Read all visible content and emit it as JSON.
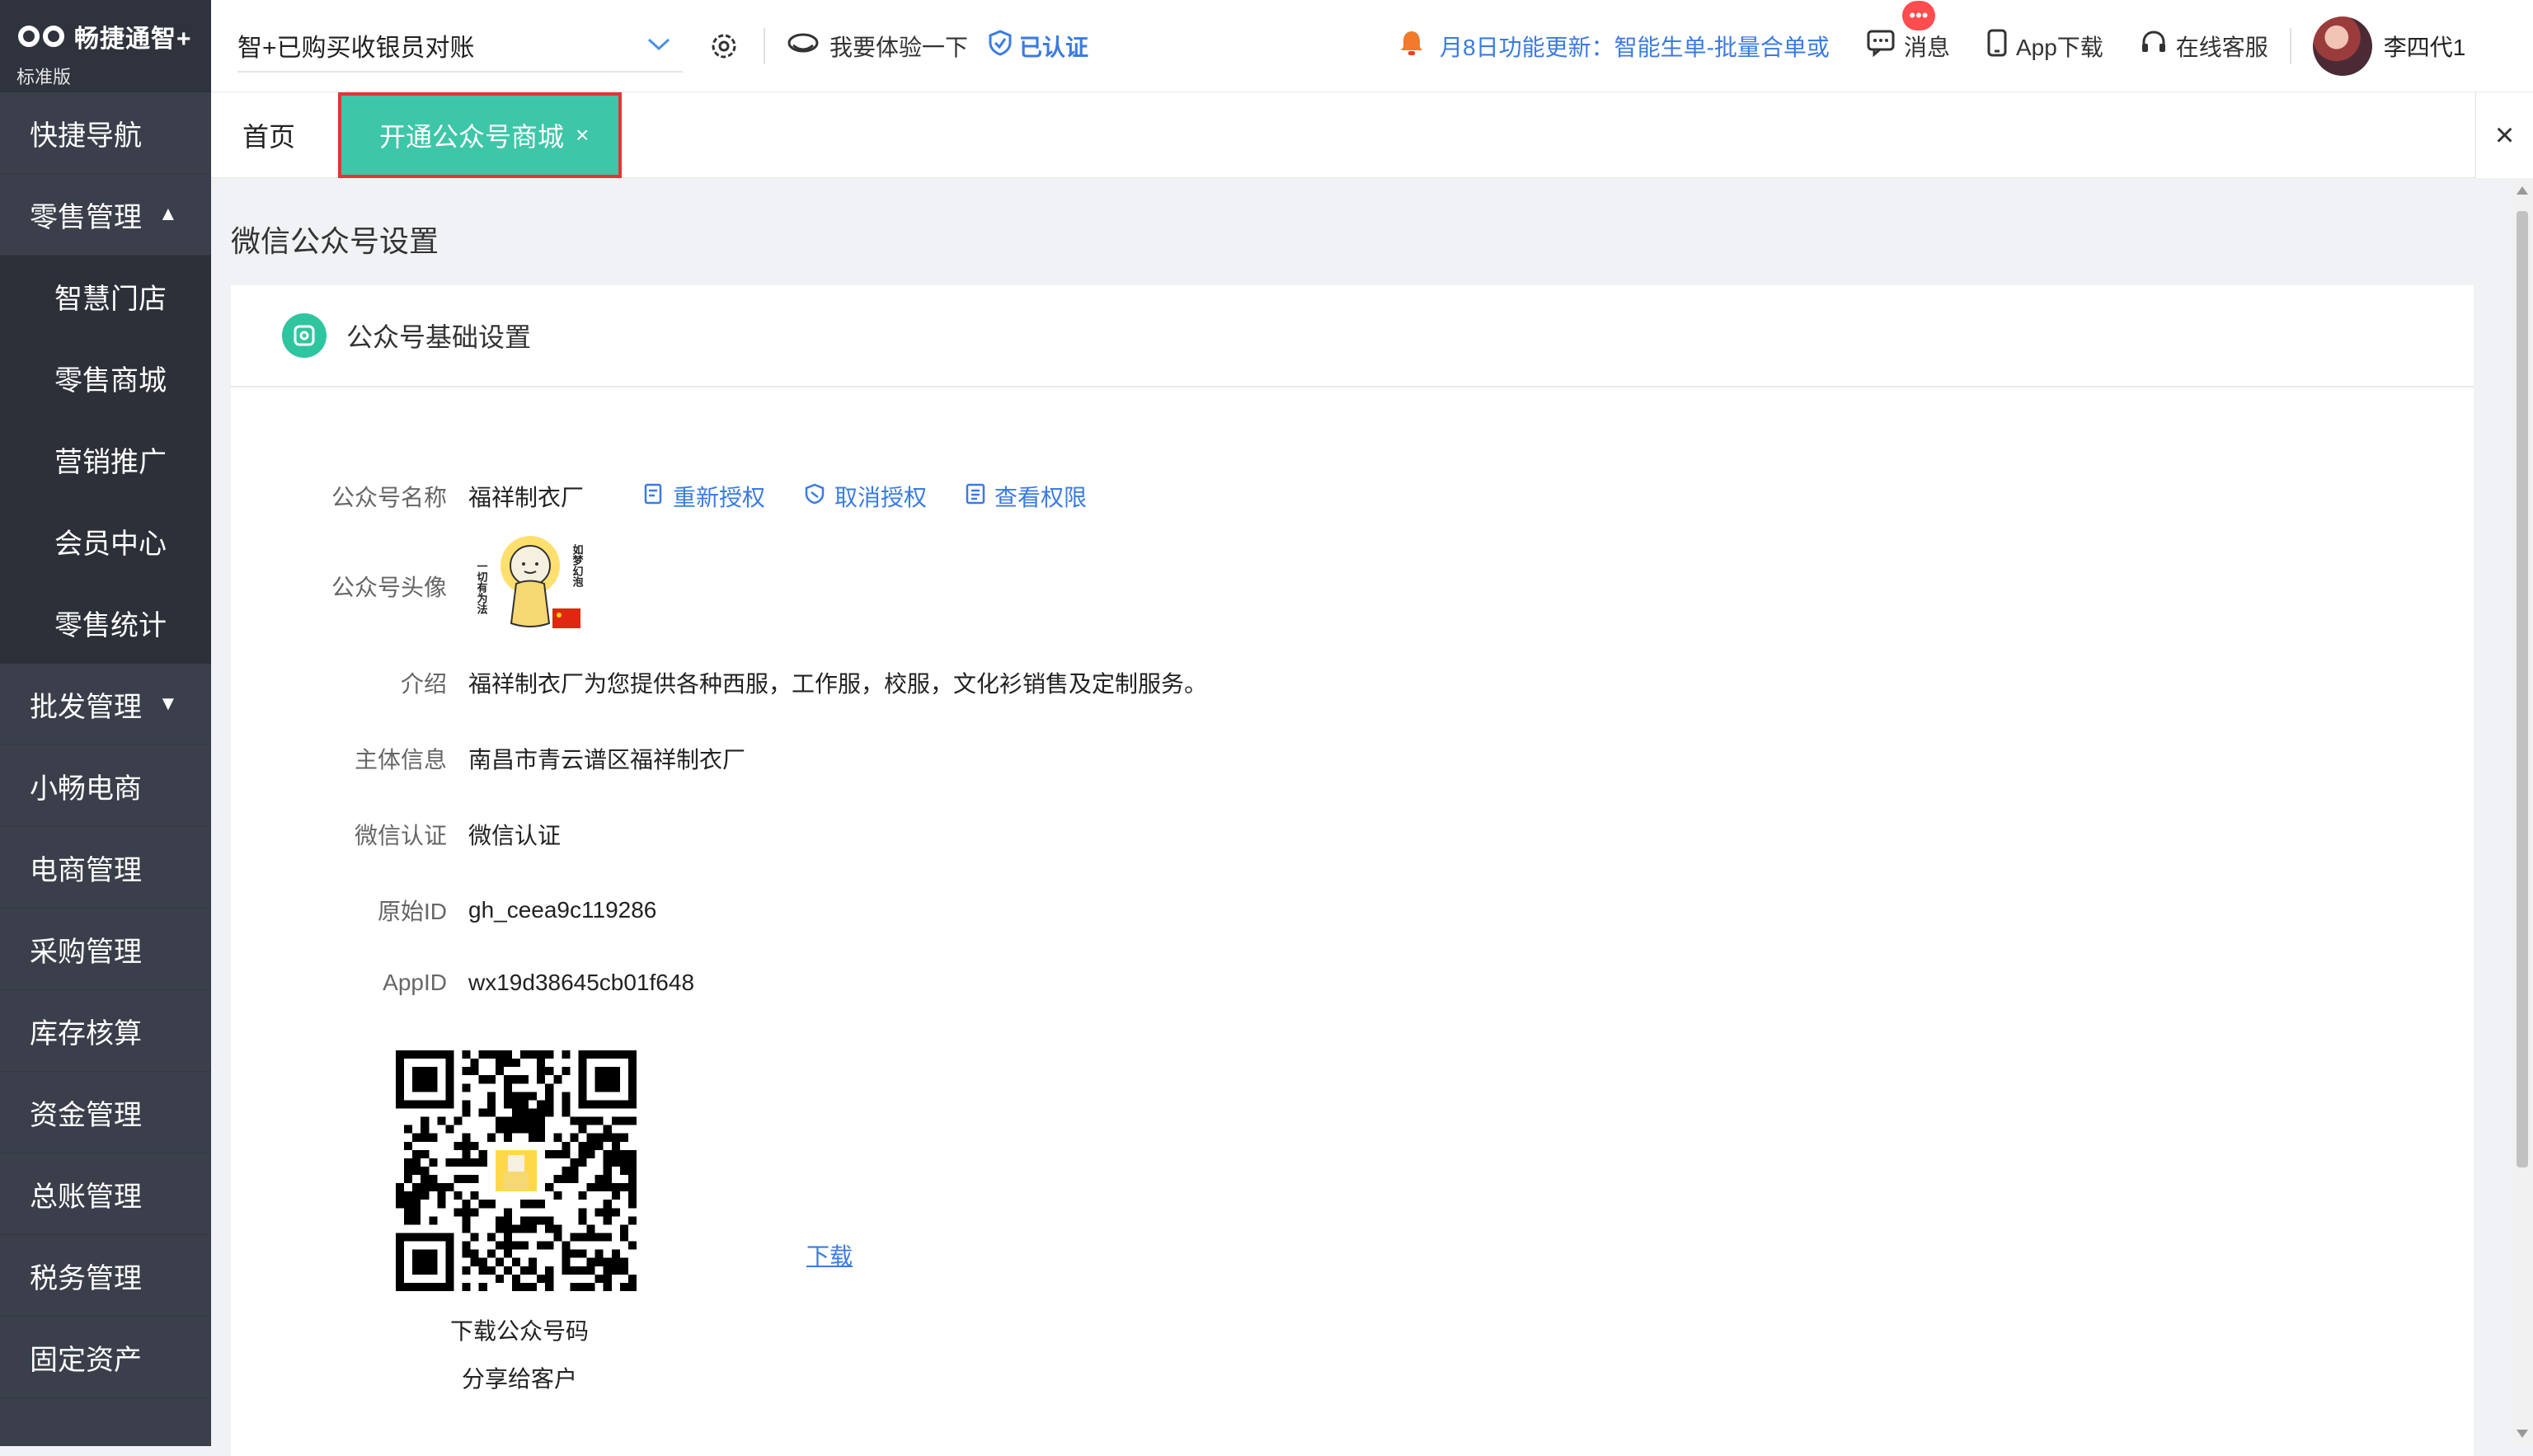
{
  "logo": {
    "brand": "畅捷通智+",
    "edition": "标准版"
  },
  "sidebar": {
    "items": [
      {
        "label": "快捷导航"
      },
      {
        "label": "零售管理",
        "caret": "▲"
      },
      {
        "label": "智慧门店"
      },
      {
        "label": "零售商城"
      },
      {
        "label": "营销推广"
      },
      {
        "label": "会员中心"
      },
      {
        "label": "零售统计"
      },
      {
        "label": "批发管理",
        "caret": "▼"
      },
      {
        "label": "小畅电商"
      },
      {
        "label": "电商管理"
      },
      {
        "label": "采购管理"
      },
      {
        "label": "库存核算"
      },
      {
        "label": "资金管理"
      },
      {
        "label": "总账管理"
      },
      {
        "label": "税务管理"
      },
      {
        "label": "固定资产"
      }
    ]
  },
  "topbar": {
    "company": "智+已购买收银员对账",
    "trial": "我要体验一下",
    "verified": "已认证",
    "notice": "月8日功能更新：智能生单-批量合单或",
    "messages": "消息",
    "message_badge": "•••",
    "app_download": "App下载",
    "support": "在线客服",
    "user": "李四代1"
  },
  "tabs": {
    "home": "首页",
    "active": "开通公众号商城",
    "active_close": "×",
    "close_all": "×"
  },
  "page": {
    "title": "微信公众号设置",
    "section": "公众号基础设置",
    "fields": {
      "name_label": "公众号名称",
      "name_value": "福祥制衣厂",
      "avatar_label": "公众号头像",
      "intro_label": "介绍",
      "intro_value": "福祥制衣厂为您提供各种西服，工作服，校服，文化衫销售及定制服务。",
      "subject_label": "主体信息",
      "subject_value": "南昌市青云谱区福祥制衣厂",
      "cert_label": "微信认证",
      "cert_value": "微信认证",
      "origin_label": "原始ID",
      "origin_value": "gh_ceea9c119286",
      "appid_label": "AppID",
      "appid_value": "wx19d38645cb01f648"
    },
    "actions": {
      "reauth": "重新授权",
      "cancel_auth": "取消授权",
      "view_perm": "查看权限"
    },
    "avatar_text": {
      "left": "一切有为法",
      "right": "如梦幻泡"
    },
    "qr_caption_1": "下载公众号码",
    "qr_caption_2": "分享给客户",
    "download": "下载"
  },
  "colors": {
    "sidebar_bg": "#3a3f4b",
    "accent_teal": "#3ec6a8",
    "link_blue": "#3b7be0",
    "highlight_red": "#e43434"
  }
}
